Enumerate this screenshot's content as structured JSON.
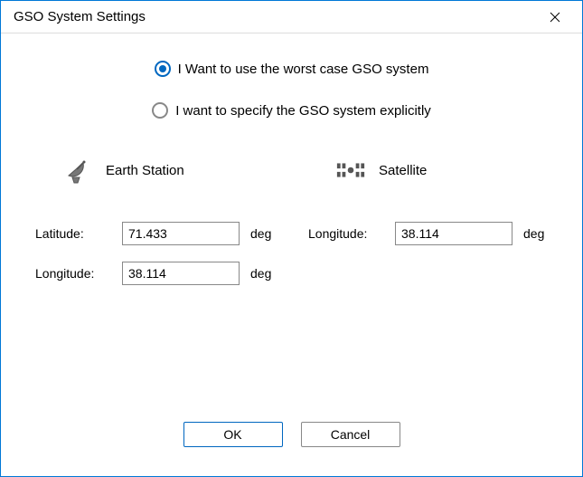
{
  "window": {
    "title": "GSO System Settings"
  },
  "options": {
    "worst_case_label": "I Want to use the worst case GSO system",
    "explicit_label": "I want to specify the GSO system explicitly",
    "selected": "worst_case"
  },
  "earth_station": {
    "title": "Earth Station",
    "latitude_label": "Latitude:",
    "latitude_value": "71.433",
    "latitude_unit": "deg",
    "longitude_label": "Longitude:",
    "longitude_value": "38.114",
    "longitude_unit": "deg"
  },
  "satellite": {
    "title": "Satellite",
    "longitude_label": "Longitude:",
    "longitude_value": "38.114",
    "longitude_unit": "deg"
  },
  "buttons": {
    "ok": "OK",
    "cancel": "Cancel"
  }
}
